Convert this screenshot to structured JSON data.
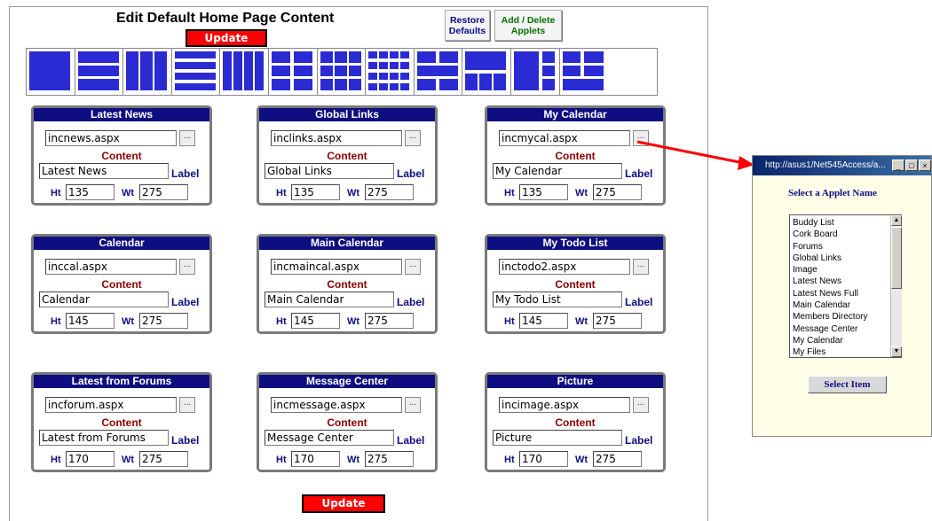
{
  "page": {
    "title": "Edit Default Home Page Content",
    "update_label": "Update",
    "restore_label_1": "Restore",
    "restore_label_2": "Defaults",
    "add_label_1": "Add / Delete",
    "add_label_2": "Applets"
  },
  "colors": {
    "header": "#0e0e80",
    "update": "#ff0000",
    "content_label": "#8b0000",
    "layout_block": "#2b2bd4",
    "popup_bg": "#ffffe8"
  },
  "panel_labels": {
    "content": "Content",
    "label": "Label",
    "ht": "Ht",
    "wt": "Wt"
  },
  "panels": [
    {
      "title": "Latest News",
      "file": "incnews.aspx",
      "label": "Latest News",
      "ht": "135",
      "wt": "275"
    },
    {
      "title": "Global Links",
      "file": "inclinks.aspx",
      "label": "Global Links",
      "ht": "135",
      "wt": "275"
    },
    {
      "title": "My Calendar",
      "file": "incmycal.aspx",
      "label": "My Calendar",
      "ht": "135",
      "wt": "275"
    },
    {
      "title": "Calendar",
      "file": "inccal.aspx",
      "label": "Calendar",
      "ht": "145",
      "wt": "275"
    },
    {
      "title": "Main Calendar",
      "file": "incmaincal.aspx",
      "label": "Main Calendar",
      "ht": "145",
      "wt": "275"
    },
    {
      "title": "My Todo List",
      "file": "inctodo2.aspx",
      "label": "My Todo List",
      "ht": "145",
      "wt": "275"
    },
    {
      "title": "Latest from Forums",
      "file": "incforum.aspx",
      "label": "Latest from Forums",
      "ht": "170",
      "wt": "275"
    },
    {
      "title": "Message Center",
      "file": "incmessage.aspx",
      "label": "Message Center",
      "ht": "170",
      "wt": "275"
    },
    {
      "title": "Picture",
      "file": "incimage.aspx",
      "label": "Picture",
      "ht": "170",
      "wt": "275"
    }
  ],
  "popup": {
    "window_title": "http://asus1/Net545Access/a...",
    "heading": "Select a Applet Name",
    "items": [
      "Buddy List",
      "Cork Board",
      "Forums",
      "Global Links",
      "Image",
      "Latest News",
      "Latest News Full",
      "Main Calendar",
      "Members Directory",
      "Message Center",
      "My Calendar",
      "My Files"
    ],
    "select_label": "Select Item"
  },
  "icons": {
    "browse": "ellipsis-icon",
    "arrow": "red-arrow-icon"
  }
}
